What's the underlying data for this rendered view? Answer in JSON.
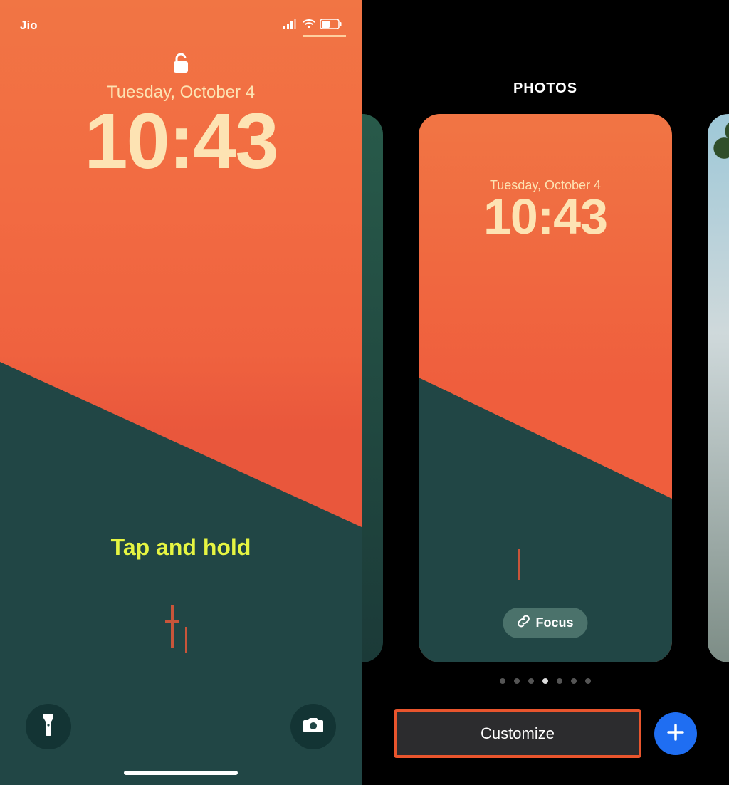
{
  "left": {
    "carrier": "Jio",
    "date": "Tuesday, October 4",
    "time": "10:43",
    "instruction": "Tap and hold"
  },
  "right": {
    "title": "PHOTOS",
    "card": {
      "date": "Tuesday, October 4",
      "time": "10:43",
      "focus_label": "Focus"
    },
    "page_dots": {
      "count": 7,
      "active": 3
    },
    "customize_label": "Customize"
  },
  "colors": {
    "sky_top": "#f17544",
    "sky_bottom": "#ef5e3d",
    "terrain": "#214645",
    "time_color": "#fde3b3",
    "instruction_color": "#e6f542",
    "highlight_box": "#e9552d",
    "add_button": "#1f6ef2"
  },
  "icons": {
    "lock": "lock-open-icon",
    "signal": "cellular-signal-icon",
    "wifi": "wifi-icon",
    "battery": "battery-icon",
    "flashlight": "flashlight-icon",
    "camera": "camera-icon",
    "link": "link-icon",
    "plus": "plus-icon"
  }
}
